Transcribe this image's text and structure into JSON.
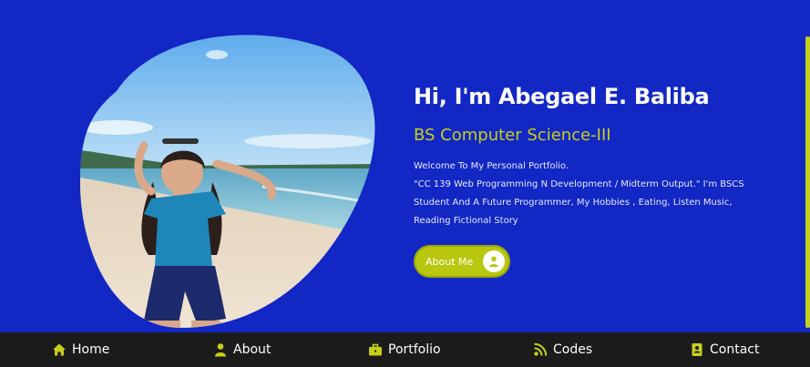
{
  "hero": {
    "name": "Hi, I'm Abegael E. Baliba",
    "role": "BS Computer Science-III",
    "desc_line1": "Welcome To My Personal Portfolio.",
    "desc_line2": "\"CC 139 Web Programming N Development / Midterm Output.\" I'm BSCS",
    "desc_line3": "Student And A Future Programmer, My Hobbies , Eating, Listen Music,",
    "desc_line4": "Reading Fictional Story",
    "about_button": "About Me"
  },
  "colors": {
    "background": "#1227c4",
    "accent": "#c5d01a",
    "nav_bg": "#1b1b1b"
  },
  "nav": {
    "items": [
      {
        "label": "Home",
        "icon": "home-icon"
      },
      {
        "label": "About",
        "icon": "user-icon"
      },
      {
        "label": "Portfolio",
        "icon": "briefcase-icon"
      },
      {
        "label": "Codes",
        "icon": "code-icon"
      },
      {
        "label": "Contact",
        "icon": "address-book-icon"
      }
    ]
  }
}
